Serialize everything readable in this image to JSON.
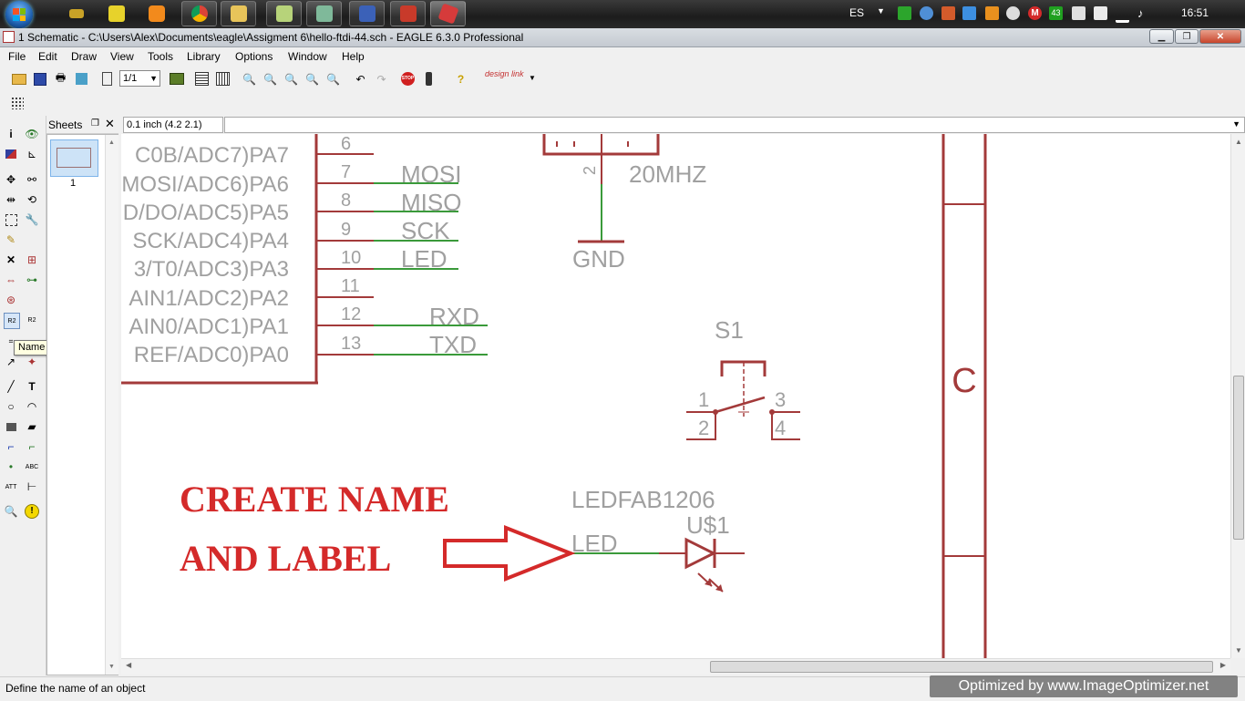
{
  "taskbar": {
    "language": "ES",
    "clock": "16:51",
    "badge_count": "43",
    "mail_letter": "M"
  },
  "window": {
    "title": "1 Schematic - C:\\Users\\Alex\\Documents\\eagle\\Assigment 6\\hello-ftdi-44.sch - EAGLE 6.3.0 Professional"
  },
  "menu": [
    "File",
    "Edit",
    "Draw",
    "View",
    "Tools",
    "Library",
    "Options",
    "Window",
    "Help"
  ],
  "toolbar": {
    "zoom_value": "1/1",
    "designlink_label": "design link"
  },
  "tooltip": "Name",
  "sheets": {
    "title": "Sheets",
    "items": [
      {
        "number": "1"
      }
    ]
  },
  "coordinate": "0.1 inch (4.2 2.1)",
  "schematic": {
    "pin_labels": [
      "C0B/ADC7)PA7",
      "MOSI/ADC6)PA6",
      "D/DO/ADC5)PA5",
      "SCK/ADC4)PA4",
      "3/T0/ADC3)PA3",
      "AIN1/ADC2)PA2",
      "AIN0/ADC1)PA1",
      "REF/ADC0)PA0"
    ],
    "pin_numbers": [
      "6",
      "7",
      "8",
      "9",
      "10",
      "11",
      "12",
      "13"
    ],
    "net_labels": [
      "MOSI",
      "MISO",
      "SCK",
      "LED",
      "RXD",
      "TXD"
    ],
    "crystal_pin": "2",
    "crystal_value": "20MHZ",
    "gnd_label": "GND",
    "switch_name": "S1",
    "switch_pins": [
      "1",
      "2",
      "3",
      "4"
    ],
    "led_value": "LEDFAB1206",
    "led_name": "U$1",
    "led_net": "LED",
    "frame_letter": "C"
  },
  "annotation": {
    "line1": "CREATE NAME",
    "line2": "AND LABEL",
    "color": "#d42a2a"
  },
  "colors": {
    "part": "#a33a3a",
    "text": "#a0a0a0",
    "wire": "#3a9a3a"
  },
  "status": {
    "text": "Define the name of an object",
    "watermark": "Optimized by www.ImageOptimizer.net"
  }
}
